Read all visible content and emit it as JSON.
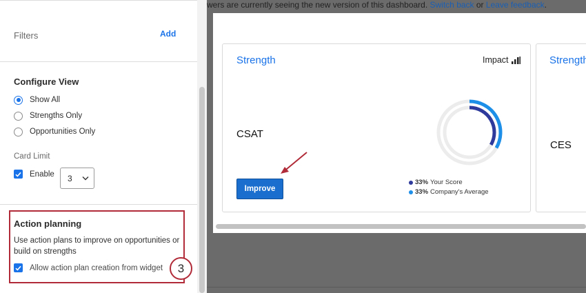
{
  "sidebar": {
    "filters": {
      "label": "Filters",
      "add_label": "Add"
    },
    "configure_view": {
      "title": "Configure View",
      "options": [
        {
          "label": "Show All",
          "checked": true
        },
        {
          "label": "Strengths Only",
          "checked": false
        },
        {
          "label": "Opportunities Only",
          "checked": false
        }
      ]
    },
    "card_limit": {
      "label": "Card Limit",
      "enable_label": "Enable",
      "enabled": true,
      "value": "3"
    },
    "action_planning": {
      "title": "Action planning",
      "description": "Use action plans to improve on opportunities or build on strengths",
      "checkbox_label": "Allow action plan creation from widget",
      "checked": true,
      "step_number": "3"
    }
  },
  "notice": {
    "text_before": "wers are currently seeing the new version of this dashboard. ",
    "switch_back": "Switch back",
    "or": " or ",
    "leave_feedback": "Leave feedback",
    "period": "."
  },
  "cards": [
    {
      "title": "Strength",
      "impact_label": "Impact",
      "metric": "CSAT",
      "button_label": "Improve",
      "legend": [
        {
          "value": "33%",
          "label": "Your Score",
          "color": "#2e3a9c"
        },
        {
          "value": "33%",
          "label": "Company's Average",
          "color": "#1e8fe8"
        }
      ]
    },
    {
      "title": "Strength",
      "metric": "CES"
    }
  ],
  "colors": {
    "accent": "#1a73e8",
    "highlight_border": "#b02a37",
    "your_score": "#2e3a9c",
    "company_average": "#1e8fe8",
    "ring_track": "#ececec"
  }
}
